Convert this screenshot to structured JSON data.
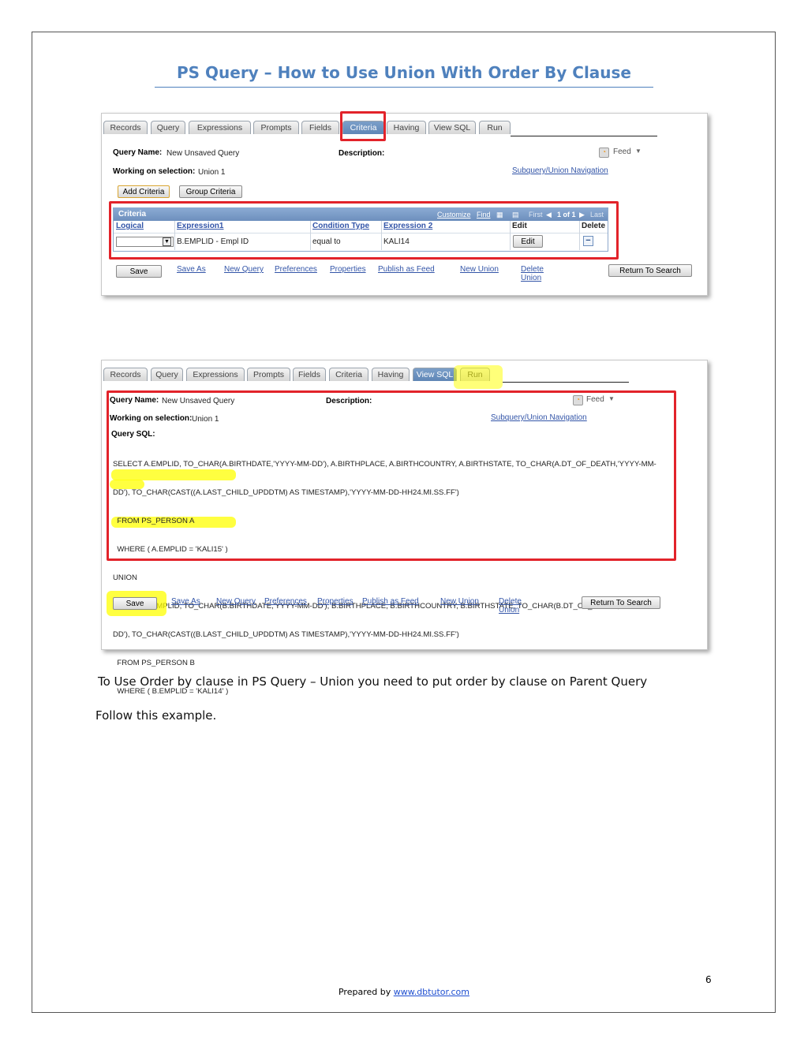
{
  "document": {
    "title": "PS Query – How to Use Union With Order By Clause",
    "paragraph1": "To Use Order by clause in PS Query – Union you need to put order by clause on Parent Query",
    "paragraph2": "Follow this example.",
    "page_number": "6",
    "footer_prefix": "Prepared by",
    "footer_link": "www.dbtutor.com"
  },
  "tabs": [
    "Records",
    "Query",
    "Expressions",
    "Prompts",
    "Fields",
    "Criteria",
    "Having",
    "View SQL",
    "Run"
  ],
  "shot1": {
    "active_tab": "Criteria",
    "query_name_label": "Query Name:",
    "query_name_value": "New Unsaved Query",
    "description_label": "Description:",
    "feed_label": "Feed",
    "working_label": "Working on selection:",
    "working_value": "Union 1",
    "subquery_link": "Subquery/Union Navigation",
    "add_criteria_button": "Add Criteria",
    "group_criteria_button": "Group Criteria",
    "grid": {
      "title": "Criteria",
      "nav_customize": "Customize",
      "nav_find": "Find",
      "nav_first": "First",
      "nav_count": "1 of 1",
      "nav_last": "Last",
      "columns": [
        "Logical",
        "Expression1",
        "Condition Type",
        "Expression 2",
        "Edit",
        "Delete"
      ],
      "row": {
        "expression1": "B.EMPLID - Empl ID",
        "condition": "equal to",
        "expression2": "KALI14",
        "edit_button": "Edit",
        "delete_symbol": "−"
      }
    }
  },
  "shot2": {
    "active_tab": "View SQL",
    "query_name_label": "Query Name:",
    "query_name_value": "New Unsaved Query",
    "description_label": "Description:",
    "feed_label": "Feed",
    "working_label": "Working on selection:",
    "working_value": "Union 1",
    "subquery_link": "Subquery/Union Navigation",
    "sql_label": "Query SQL:",
    "sql_lines": [
      "SELECT A.EMPLID, TO_CHAR(A.BIRTHDATE,'YYYY-MM-DD'), A.BIRTHPLACE, A.BIRTHCOUNTRY, A.BIRTHSTATE, TO_CHAR(A.DT_OF_DEATH,'YYYY-MM-",
      "DD'), TO_CHAR(CAST((A.LAST_CHILD_UPDDTM) AS TIMESTAMP),'YYYY-MM-DD-HH24.MI.SS.FF')",
      "  FROM PS_PERSON A",
      "  WHERE ( A.EMPLID = 'KALI15' )",
      "UNION",
      "SELECT B.EMPLID, TO_CHAR(B.BIRTHDATE,'YYYY-MM-DD'), B.BIRTHPLACE, B.BIRTHCOUNTRY, B.BIRTHSTATE, TO_CHAR(B.DT_OF_DEATH,'YYYY-MM-",
      "DD'), TO_CHAR(CAST((B.LAST_CHILD_UPDDTM) AS TIMESTAMP),'YYYY-MM-DD-HH24.MI.SS.FF')",
      "  FROM PS_PERSON B",
      "  WHERE ( B.EMPLID = 'KALI14' )"
    ]
  },
  "toolbar": {
    "save": "Save",
    "save_as": "Save As",
    "new_query": "New Query",
    "preferences": "Preferences",
    "properties": "Properties",
    "publish_feed": "Publish as Feed",
    "new_union": "New Union",
    "delete_union_1": "Delete",
    "delete_union_2": "Union",
    "return_search": "Return To Search"
  },
  "colors": {
    "title_blue": "#4f81bd",
    "annotation_red": "#e2232a",
    "highlight_yellow": "#ffff00",
    "link_blue": "#3355a8"
  }
}
